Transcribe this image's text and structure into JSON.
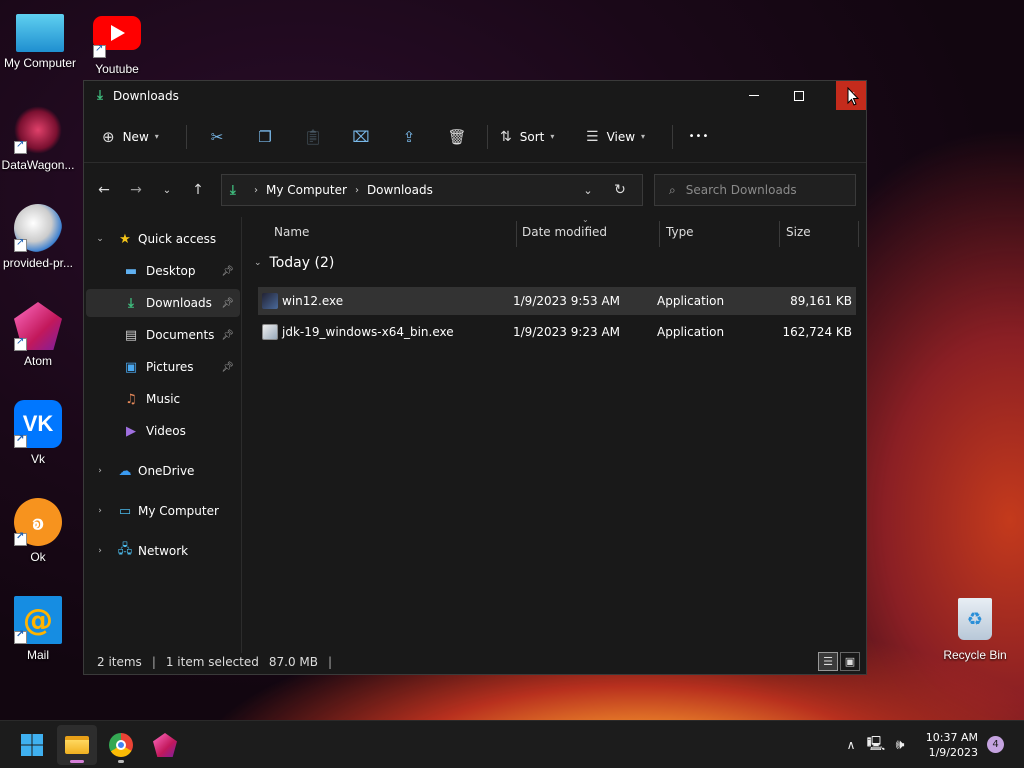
{
  "desktop": {
    "icons": [
      {
        "label": "My Computer",
        "icon": "monitor-icon"
      },
      {
        "label": "Youtube",
        "icon": "youtube-icon"
      },
      {
        "label": "DataWagon...",
        "icon": "datawagon-icon"
      },
      {
        "label": "provided-pr...",
        "icon": "provided-program-icon"
      },
      {
        "label": "Atom",
        "icon": "atom-icon"
      },
      {
        "label": "Vk",
        "icon": "vk-icon"
      },
      {
        "label": "Ok",
        "icon": "ok-icon"
      },
      {
        "label": "Mail",
        "icon": "mail-icon"
      },
      {
        "label": "Recycle Bin",
        "icon": "recycle-bin-icon"
      }
    ]
  },
  "window": {
    "title": "Downloads",
    "controls": {
      "minimize": "—",
      "maximize": "☐",
      "close": "✕"
    }
  },
  "toolbar": {
    "new_label": "New",
    "sort_label": "Sort",
    "view_label": "View",
    "more_label": "•••"
  },
  "address": {
    "segments": [
      "My Computer",
      "Downloads"
    ]
  },
  "search": {
    "placeholder": "Search Downloads"
  },
  "sidebar": {
    "quick_access": "Quick access",
    "items": [
      {
        "label": "Desktop",
        "pinned": true
      },
      {
        "label": "Downloads",
        "pinned": true,
        "selected": true
      },
      {
        "label": "Documents",
        "pinned": true
      },
      {
        "label": "Pictures",
        "pinned": true
      },
      {
        "label": "Music",
        "pinned": false
      },
      {
        "label": "Videos",
        "pinned": false
      }
    ],
    "onedrive": "OneDrive",
    "my_computer": "My Computer",
    "network": "Network"
  },
  "columns": {
    "name": "Name",
    "date": "Date modified",
    "type": "Type",
    "size": "Size"
  },
  "group": {
    "label": "Today (2)"
  },
  "files": [
    {
      "name": "win12.exe",
      "date": "1/9/2023 9:53 AM",
      "type": "Application",
      "size": "89,161 KB",
      "selected": true
    },
    {
      "name": "jdk-19_windows-x64_bin.exe",
      "date": "1/9/2023 9:23 AM",
      "type": "Application",
      "size": "162,724 KB",
      "selected": false
    }
  ],
  "status": {
    "items": "2 items",
    "selected": "1 item selected",
    "size": "87.0 MB"
  },
  "taskbar": {
    "time": "10:37 AM",
    "date": "1/9/2023",
    "notifications": "4"
  },
  "colors": {
    "accent": "#3fbf7f",
    "close_red": "#c42b1c",
    "window_bg": "#191919"
  }
}
